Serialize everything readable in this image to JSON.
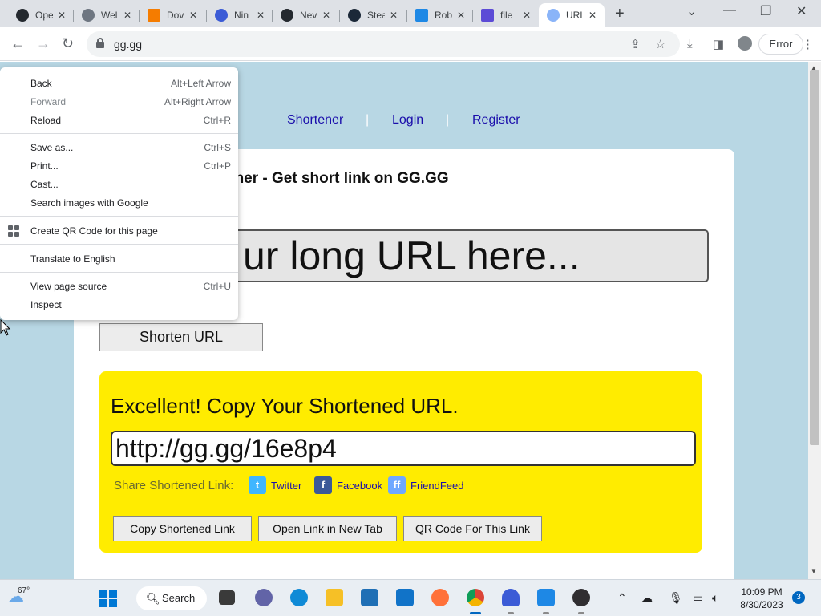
{
  "browser": {
    "tabs": [
      {
        "label": "Ope",
        "icon": "github-icon",
        "color": "#24292f"
      },
      {
        "label": "Wel",
        "icon": "globe-icon",
        "color": "#6e7681"
      },
      {
        "label": "Dov",
        "icon": "vlc-icon",
        "color": "#f57c00"
      },
      {
        "label": "Nin",
        "icon": "ninite-icon",
        "color": "#3b5bd6"
      },
      {
        "label": "Nev",
        "icon": "github-icon",
        "color": "#24292f"
      },
      {
        "label": "Stea",
        "icon": "steam-icon",
        "color": "#1b2838"
      },
      {
        "label": "Rob",
        "icon": "roblox-studio-icon",
        "color": "#1e88e5"
      },
      {
        "label": "file",
        "icon": "file-icon",
        "color": "#5c4bd6"
      },
      {
        "label": "URL",
        "icon": "link-icon",
        "color": "#8ab4f8",
        "active": true
      }
    ],
    "url": "gg.gg",
    "profile_button": "Error"
  },
  "page": {
    "nav": [
      "Shortener",
      "Login",
      "Register"
    ],
    "title": "ener - Get short link on GG.GG",
    "long_url_placeholder": "ur long URL here...",
    "shorten_button": "Shorten URL",
    "result": {
      "heading": "Excellent! Copy Your Shortened URL.",
      "short_url": "http://gg.gg/16e8p4",
      "share_label": "Share Shortened Link:",
      "share": [
        {
          "label": "Twitter",
          "icon": "twitter-icon",
          "color": "#3fb6ff"
        },
        {
          "label": "Facebook",
          "icon": "facebook-icon",
          "color": "#3b5998"
        },
        {
          "label": "FriendFeed",
          "icon": "friendfeed-icon",
          "color": "#6fa8ff"
        }
      ],
      "buttons": [
        "Copy Shortened Link",
        "Open Link in New Tab",
        "QR Code For This Link"
      ]
    },
    "colors": {
      "background": "#b8d7e4",
      "result_panel": "#ffec00"
    }
  },
  "context_menu": {
    "items": [
      {
        "label": "Back",
        "shortcut": "Alt+Left Arrow"
      },
      {
        "label": "Forward",
        "shortcut": "Alt+Right Arrow",
        "disabled": true
      },
      {
        "label": "Reload",
        "shortcut": "Ctrl+R"
      },
      {
        "label": "Save as...",
        "shortcut": "Ctrl+S"
      },
      {
        "label": "Print...",
        "shortcut": "Ctrl+P"
      },
      {
        "label": "Cast...",
        "shortcut": ""
      },
      {
        "label": "Search images with Google",
        "shortcut": ""
      },
      {
        "label": "Create QR Code for this page",
        "shortcut": ""
      },
      {
        "label": "Translate to English",
        "shortcut": ""
      },
      {
        "label": "View page source",
        "shortcut": "Ctrl+U"
      },
      {
        "label": "Inspect",
        "shortcut": ""
      }
    ]
  },
  "taskbar": {
    "weather": "67°",
    "search": "Search",
    "time": "10:09 PM",
    "date": "8/30/2023",
    "notifications": "3"
  }
}
